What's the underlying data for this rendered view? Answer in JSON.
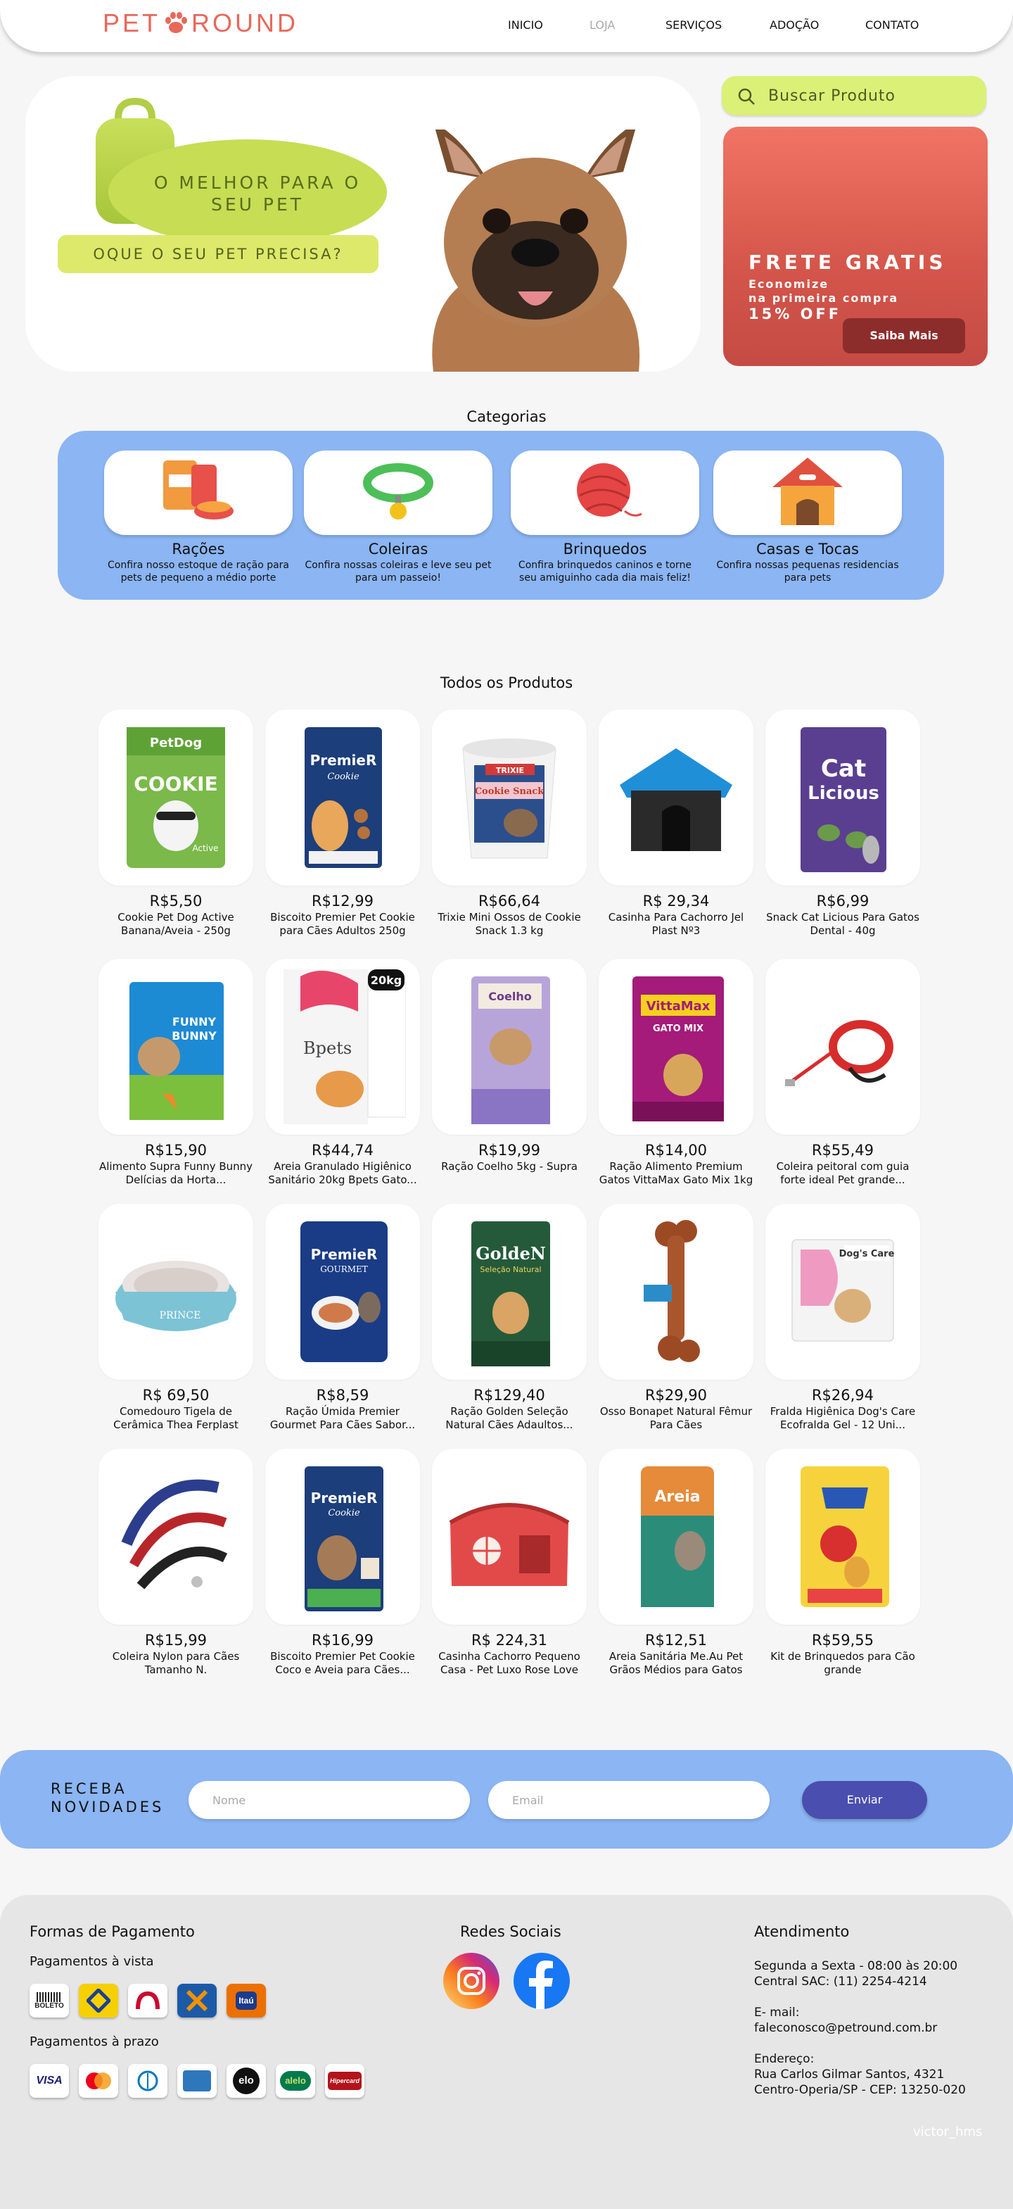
{
  "header": {
    "logo_left": "PET",
    "logo_right": "ROUND",
    "nav": [
      "INICIO",
      "LOJA",
      "SERVIÇOS",
      "ADOÇÃO",
      "CONTATO"
    ]
  },
  "hero": {
    "slogan": "O MELHOR PARA O SEU PET",
    "cta": "OQUE O SEU PET PRECISA?"
  },
  "search": {
    "placeholder": "Buscar Produto"
  },
  "promo": {
    "title": "FRETE GRATIS",
    "line1": "Economize",
    "line2": "na primeira compra",
    "discount": "15% OFF",
    "button": "Saiba Mais"
  },
  "categories": {
    "title": "Categorias",
    "items": [
      {
        "name": "Rações",
        "desc": "Confira nosso estoque de ração para pets de pequeno a médio porte"
      },
      {
        "name": "Coleiras",
        "desc": "Confira nossas coleiras  e leve seu pet para um passeio!"
      },
      {
        "name": "Brinquedos",
        "desc": "Confira brinquedos caninos e torne seu amiguinho cada dia mais feliz!"
      },
      {
        "name": "Casas e Tocas",
        "desc": "Confira nossas pequenas residencias para pets"
      }
    ]
  },
  "products": {
    "title": "Todos os Produtos",
    "items": [
      {
        "price": "R$5,50",
        "name": "Cookie Pet Dog Active Banana/Aveia - 250g"
      },
      {
        "price": "R$12,99",
        "name": "Biscoito Premier Pet Cookie para Cães Adultos 250g"
      },
      {
        "price": "R$66,64",
        "name": "Trixie Mini Ossos de Cookie Snack 1.3 kg"
      },
      {
        "price": "R$ 29,34",
        "name": "Casinha Para Cachorro Jel Plast Nº3"
      },
      {
        "price": "R$6,99",
        "name": "Snack Cat Licious Para Gatos Dental - 40g"
      },
      {
        "price": "R$15,90",
        "name": "Alimento Supra Funny Bunny Delícias da Horta..."
      },
      {
        "price": "R$44,74",
        "name": "Areia Granulado Higiênico Sanitário 20kg Bpets Gato..."
      },
      {
        "price": "R$19,99",
        "name": "Ração Coelho 5kg - Supra"
      },
      {
        "price": "R$14,00",
        "name": "Ração Alimento Premium Gatos VittaMax Gato Mix 1kg"
      },
      {
        "price": "R$55,49",
        "name": "Coleira peitoral com guia forte ideal Pet grande..."
      },
      {
        "price": "R$ 69,50",
        "name": "Comedouro Tigela de Cerâmica Thea Ferplast"
      },
      {
        "price": "R$8,59",
        "name": "Ração Úmida Premier Gourmet Para Cães Sabor..."
      },
      {
        "price": "R$129,40",
        "name": "Ração Golden Seleção Natural Cães Adaultos..."
      },
      {
        "price": "R$29,90",
        "name": "Osso Bonapet Natural Fêmur Para Cães"
      },
      {
        "price": "R$26,94",
        "name": "Fralda Higiênica Dog's Care Ecofralda Gel - 12 Uni..."
      },
      {
        "price": "R$15,99",
        "name": "Coleira Nylon para Cães Tamanho N."
      },
      {
        "price": "R$16,99",
        "name": "Biscoito Premier Pet Cookie Coco e Aveia para Cães..."
      },
      {
        "price": "R$ 224,31",
        "name": "Casinha Cachorro Pequeno Casa - Pet Luxo Rose Love"
      },
      {
        "price": "R$12,51",
        "name": "Areia Sanitária Me.Au Pet Grãos Médios para Gatos"
      },
      {
        "price": "R$59,55",
        "name": "Kit de Brinquedos para Cão grande"
      }
    ],
    "labels": {
      "petdog": "PetDog",
      "cookie": "COOKIE",
      "active": "Active",
      "premier": "PremieR",
      "cookie2": "Cookie",
      "trixie": "TRIXIE",
      "cookie_snack": "Cookie Snack",
      "cat": "Cat",
      "licious": "Licious",
      "funny": "FUNNY",
      "bunny": "BUNNY",
      "bpets": "Bpets",
      "kg20": "20kg",
      "coelho": "Coelho",
      "vittamax": "VittaMax",
      "gato_mix": "GATO MIX",
      "prince": "PRINCE",
      "gourmet": "GOURMET",
      "golden": "GoldeN",
      "selecao": "Seleção Natural",
      "dogs_care": "Dog's Care",
      "areia": "Areia"
    }
  },
  "newsletter": {
    "label_line1": "RECEBA",
    "label_line2": "NOVIDADES",
    "name_placeholder": "Nome",
    "email_placeholder": "Email",
    "button": "Enviar"
  },
  "footer": {
    "payments_title": "Formas de Pagamento",
    "cash_title": "Pagamentos à vista",
    "installments_title": "Pagamentos à prazo",
    "cash_methods": [
      "BOLETO",
      "Banco do Brasil",
      "Bradesco",
      "Caixa",
      "Itaú"
    ],
    "card_methods": [
      "VISA",
      "mastercard",
      "Diners Club",
      "American Express",
      "elo",
      "alelo",
      "Hipercard"
    ],
    "social_title": "Redes Sociais",
    "social": [
      "Instagram",
      "Facebook"
    ],
    "support_title": "Atendimento",
    "hours": "Segunda a Sexta - 08:00 às 20:00",
    "sac": "Central SAC:  (11) 2254-4214",
    "email_label": "E- mail:",
    "email": "faleconosco@petround.com.br",
    "address_label": "Endereço:",
    "address1": "Rua Carlos Gilmar Santos, 4321",
    "address2": "Centro-Operia/SP - CEP: 13250-020",
    "signature": "victor_hms"
  }
}
